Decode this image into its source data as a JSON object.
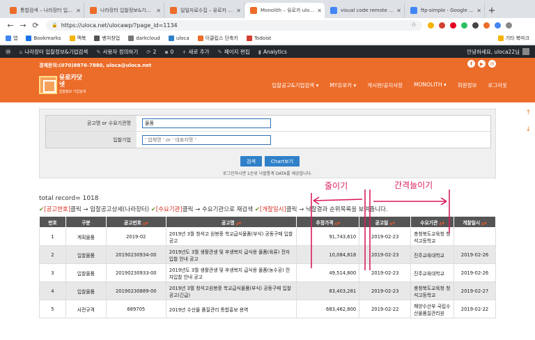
{
  "tabs": [
    {
      "title": "통합검색 – 나라장터 입찰정",
      "fav": "#ec6c2a"
    },
    {
      "title": "나라장터 입찰정보&기업검색",
      "fav": "#ec6c2a"
    },
    {
      "title": "일일자료수집 – 유로카 uloca",
      "fav": "#ec6c2a"
    },
    {
      "title": "Monolith – 유로카 uloca",
      "fav": "#ec6c2a",
      "active": true
    },
    {
      "title": "visual code remote ftp",
      "fav": "#4285f4"
    },
    {
      "title": "ftp-simple - Google 검색",
      "fav": "#4285f4"
    }
  ],
  "address": {
    "url": "https://uloca.net/ulocawp/?page_id=1134"
  },
  "bookmarks": {
    "items": [
      "앱",
      "Bookmarks",
      "맥북",
      "벤처창업",
      "darkcloud",
      "uloca",
      "이클립스 단축키",
      "Todoist"
    ],
    "other": "기타 북마크"
  },
  "wpbar": {
    "site": "나라장터 입찰정보&기업검색",
    "customize": "사용자 정의하기",
    "updates": "2",
    "comments": "0",
    "new": "새로 추가",
    "edit": "페이지 편집",
    "analytics": "Analytics",
    "greeting": "안녕하세요, uloca22님"
  },
  "header": {
    "contact": "경제문의:(070)8876-7880, uloca@uloca.net",
    "logo_title": "유로카닷넷",
    "logo_sub": "입찰정보 기업검색",
    "menu": [
      "입찰공고&기업검색 ▾",
      "MY유로카 ▾",
      "게시판/공지사항",
      "MONOLITH ▾",
      "회원정보",
      "로그아웃"
    ]
  },
  "search": {
    "label1": "공고명 or 수요기관명",
    "value1": "물품",
    "label2": "입찰기업",
    "placeholder2": "' 업체명 ' or ' 대표자명 '",
    "btn_search": "검색",
    "btn_chart": "Chart보기",
    "note": "로그인하시면 1순위 낙찰통계 DATA를 제공합니다."
  },
  "total": "total record= 1018",
  "legend": {
    "a": "[공고번호]",
    "b": "클릭 → 입찰공고상세(나라장터) ",
    "c": "[수요기관]",
    "d": "클릭 → 수요기관으로 재검색 ",
    "e": "[개찰일시]",
    "f": "클릭 → 낙찰결과 순위목록을 보여줍니다."
  },
  "table": {
    "headers": [
      "번호",
      "구분",
      "공고번호",
      "공고명",
      "추정가격",
      "공고일",
      "수요기관",
      "개찰일시"
    ],
    "rows": [
      [
        "1",
        "계획물품",
        "2019-02",
        "2019년 3월 청석고 원봉중 학교급식물품(부식) 공동구매 입찰공고",
        "91,743,610",
        "2019-02-23",
        "충청북도교육청 청석고등학교",
        ""
      ],
      [
        "2",
        "입찰물품",
        "20190230934-00",
        "2019년도 3월 생활관생 및 후생복지 급식용 물품(육류) 전자입찰 안내 공고",
        "10,084,818",
        "2019-02-23",
        "진주교육대학교",
        "2019-02-26"
      ],
      [
        "3",
        "입찰물품",
        "20190230933-00",
        "2019년도 3월 생활관생 및 후생복지 급식용 물품(농수공) 전자입찰 안내 공고",
        "49,514,800",
        "2019-02-23",
        "진주교육대학교",
        "2019-02-26"
      ],
      [
        "4",
        "입찰물품",
        "20190230889-00",
        "2019년 3월 청석고원봉중 학교급식물품(부식) 공동구매 입찰공고(긴급)",
        "83,403,281",
        "2019-02-23",
        "충청북도교육청 청석고등학교",
        "2019-02-27"
      ],
      [
        "5",
        "사전규격",
        "689705",
        "2019년 수산물 품질관리 통합홍보 용역",
        "683,462,800",
        "2019-02-22",
        "해양수산부 국립수산물품질관리원",
        "2019-02-22"
      ]
    ]
  },
  "annotations": {
    "left": "줄이기",
    "right": "간격늘이기"
  },
  "colors": {
    "brand": "#ec6c2a",
    "link": "#1a56b8",
    "accent_red": "#d52b1e",
    "annotation": "#d81b60"
  }
}
